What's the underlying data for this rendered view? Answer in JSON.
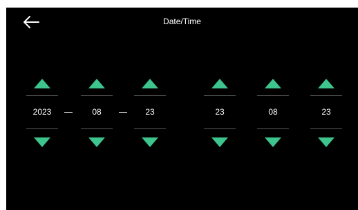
{
  "header": {
    "title": "Date/Time",
    "back_icon": "arrow-left-icon"
  },
  "date": {
    "year": "2023",
    "month": "08",
    "day": "23"
  },
  "time": {
    "hour": "23",
    "minute": "08",
    "second": "23"
  },
  "colors": {
    "background": "#000000",
    "accent": "#3ec48d",
    "divider": "#5a5a5a",
    "text": "#ffffff"
  }
}
